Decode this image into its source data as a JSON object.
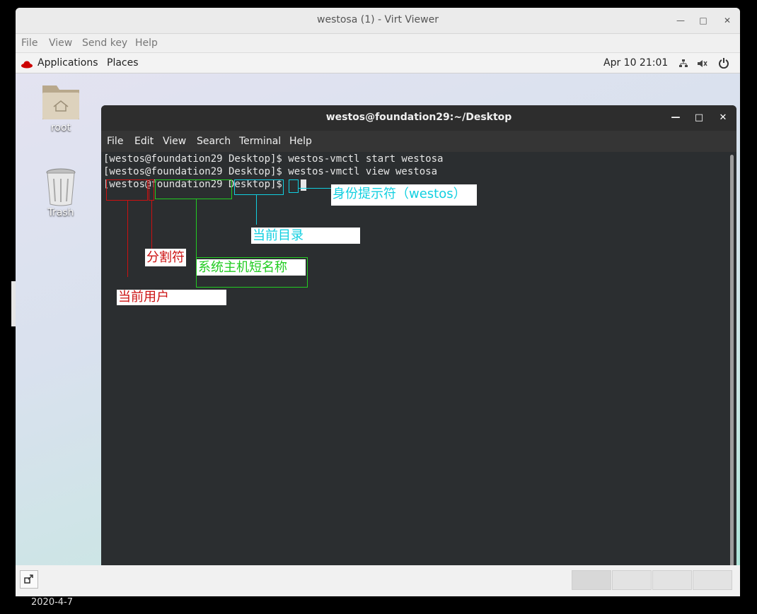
{
  "outer_window": {
    "title": "westosa (1) - Virt Viewer",
    "menu": [
      "File",
      "View",
      "Send key",
      "Help"
    ]
  },
  "guest_topbar": {
    "applications": "Applications",
    "places": "Places",
    "datetime": "Apr 10  21:01"
  },
  "desktop_icons": {
    "root": "root",
    "trash": "Trash"
  },
  "terminal": {
    "title": "westos@foundation29:~/Desktop",
    "menu": [
      "File",
      "Edit",
      "View",
      "Search",
      "Terminal",
      "Help"
    ],
    "lines": [
      "[westos@foundation29 Desktop]$ westos-vmctl start westosa",
      "[westos@foundation29 Desktop]$ westos-vmctl view westosa",
      "[westos@foundation29 Desktop]$ "
    ]
  },
  "annotations": {
    "identity_prompt": "身份提示符（westos）",
    "current_dir": "当前目录",
    "separator": "分割符",
    "hostname": "系统主机短名称",
    "current_user": "当前用户"
  },
  "colors": {
    "red": "#cc1111",
    "green": "#22cc22",
    "cyan": "#11cfe0"
  },
  "footer": {
    "date": "2020-4-7"
  }
}
